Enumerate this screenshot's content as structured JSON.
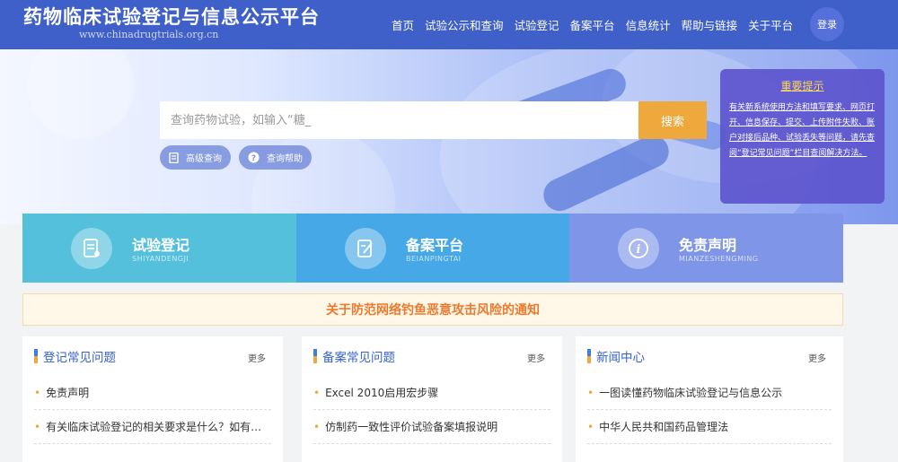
{
  "header": {
    "site_title": "药物临床试验登记与信息公示平台",
    "site_url": "www.chinadrugtrials.org.cn",
    "nav": [
      "首页",
      "试验公示和查询",
      "试验登记",
      "备案平台",
      "信息统计",
      "帮助与链接",
      "关于平台"
    ],
    "login_label": "登录"
  },
  "search": {
    "placeholder": "查询药物试验，如输入“糖_",
    "button_label": "搜索",
    "advanced_label": "高级查询",
    "help_label": "查询帮助"
  },
  "notice": {
    "title": "重要提示",
    "body": "有关新系统使用方法和填写要求、网页打开、信息保存、提交、上传附件失败、账户对接后品种、试验丢失等问题，请先查阅“登记常见问题”栏目查阅解决方法。"
  },
  "tiles": [
    {
      "label": "试验登记",
      "sub": "SHIYANDENGJI",
      "icon": "registration-doc-icon"
    },
    {
      "label": "备案平台",
      "sub": "BEIANPINGTAI",
      "icon": "edit-doc-icon"
    },
    {
      "label": "免责声明",
      "sub": "MIANZESHENGMING",
      "icon": "info-icon"
    }
  ],
  "alert": {
    "text": "关于防范网络钓鱼恶意攻击风险的通知"
  },
  "cards": [
    {
      "title": "登记常见问题",
      "more": "更多",
      "items": [
        "免责声明",
        "有关临床试验登记的相关要求是什么？如有…"
      ]
    },
    {
      "title": "备案常见问题",
      "more": "更多",
      "items": [
        "Excel 2010启用宏步骤",
        "仿制药一致性评价试验备案填报说明"
      ]
    },
    {
      "title": "新闻中心",
      "more": "更多",
      "items": [
        "一图读懂药物临床试验登记与信息公示",
        "中华人民共和国药品管理法"
      ]
    }
  ],
  "colors": {
    "header_bg": "#3f5fc9",
    "accent_orange": "#efa83c",
    "tile_1": "#55c0dc",
    "tile_2": "#46a8e6",
    "tile_3": "#7e95e8",
    "notice_bg": "#5c55cd",
    "alert_text": "#ec7a2e"
  }
}
